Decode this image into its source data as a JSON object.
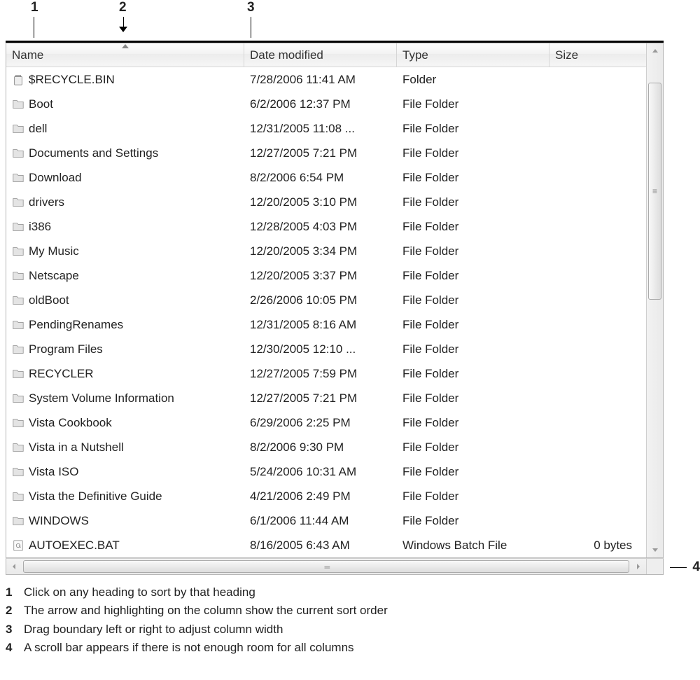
{
  "callouts": {
    "c1": "1",
    "c2": "2",
    "c3": "3",
    "c4": "4"
  },
  "columns": {
    "name": "Name",
    "date": "Date modified",
    "type": "Type",
    "size": "Size"
  },
  "rows": [
    {
      "icon": "recycle",
      "name": "$RECYCLE.BIN",
      "date": "7/28/2006 11:41 AM",
      "type": "Folder",
      "size": ""
    },
    {
      "icon": "folder",
      "name": "Boot",
      "date": "6/2/2006 12:37 PM",
      "type": "File Folder",
      "size": ""
    },
    {
      "icon": "folder",
      "name": "dell",
      "date": "12/31/2005 11:08 ...",
      "type": "File Folder",
      "size": ""
    },
    {
      "icon": "folder",
      "name": "Documents and Settings",
      "date": "12/27/2005 7:21 PM",
      "type": "File Folder",
      "size": ""
    },
    {
      "icon": "folder",
      "name": "Download",
      "date": "8/2/2006 6:54 PM",
      "type": "File Folder",
      "size": ""
    },
    {
      "icon": "folder",
      "name": "drivers",
      "date": "12/20/2005 3:10 PM",
      "type": "File Folder",
      "size": ""
    },
    {
      "icon": "folder",
      "name": "i386",
      "date": "12/28/2005 4:03 PM",
      "type": "File Folder",
      "size": ""
    },
    {
      "icon": "folder",
      "name": "My Music",
      "date": "12/20/2005 3:34 PM",
      "type": "File Folder",
      "size": ""
    },
    {
      "icon": "folder",
      "name": "Netscape",
      "date": "12/20/2005 3:37 PM",
      "type": "File Folder",
      "size": ""
    },
    {
      "icon": "folder",
      "name": "oldBoot",
      "date": "2/26/2006 10:05 PM",
      "type": "File Folder",
      "size": ""
    },
    {
      "icon": "folder",
      "name": "PendingRenames",
      "date": "12/31/2005 8:16 AM",
      "type": "File Folder",
      "size": ""
    },
    {
      "icon": "folder",
      "name": "Program Files",
      "date": "12/30/2005 12:10 ...",
      "type": "File Folder",
      "size": ""
    },
    {
      "icon": "folder",
      "name": "RECYCLER",
      "date": "12/27/2005 7:59 PM",
      "type": "File Folder",
      "size": ""
    },
    {
      "icon": "folder",
      "name": "System Volume Information",
      "date": "12/27/2005 7:21 PM",
      "type": "File Folder",
      "size": ""
    },
    {
      "icon": "folder",
      "name": "Vista Cookbook",
      "date": "6/29/2006 2:25 PM",
      "type": "File Folder",
      "size": ""
    },
    {
      "icon": "folder",
      "name": "Vista in a Nutshell",
      "date": "8/2/2006 9:30 PM",
      "type": "File Folder",
      "size": ""
    },
    {
      "icon": "folder",
      "name": "Vista ISO",
      "date": "5/24/2006 10:31 AM",
      "type": "File Folder",
      "size": ""
    },
    {
      "icon": "folder",
      "name": "Vista the Definitive Guide",
      "date": "4/21/2006 2:49 PM",
      "type": "File Folder",
      "size": ""
    },
    {
      "icon": "folder",
      "name": "WINDOWS",
      "date": "6/1/2006 11:44 AM",
      "type": "File Folder",
      "size": ""
    },
    {
      "icon": "batch",
      "name": "AUTOEXEC.BAT",
      "date": "8/16/2005 6:43 AM",
      "type": "Windows Batch File",
      "size": "0 bytes"
    }
  ],
  "legend": [
    {
      "n": "1",
      "text": "Click on any heading to sort by that heading"
    },
    {
      "n": "2",
      "text": "The arrow and highlighting on the column show the current sort order"
    },
    {
      "n": "3",
      "text": "Drag boundary left or right to adjust column width"
    },
    {
      "n": "4",
      "text": "A scroll bar appears if there is not enough room for all columns"
    }
  ]
}
